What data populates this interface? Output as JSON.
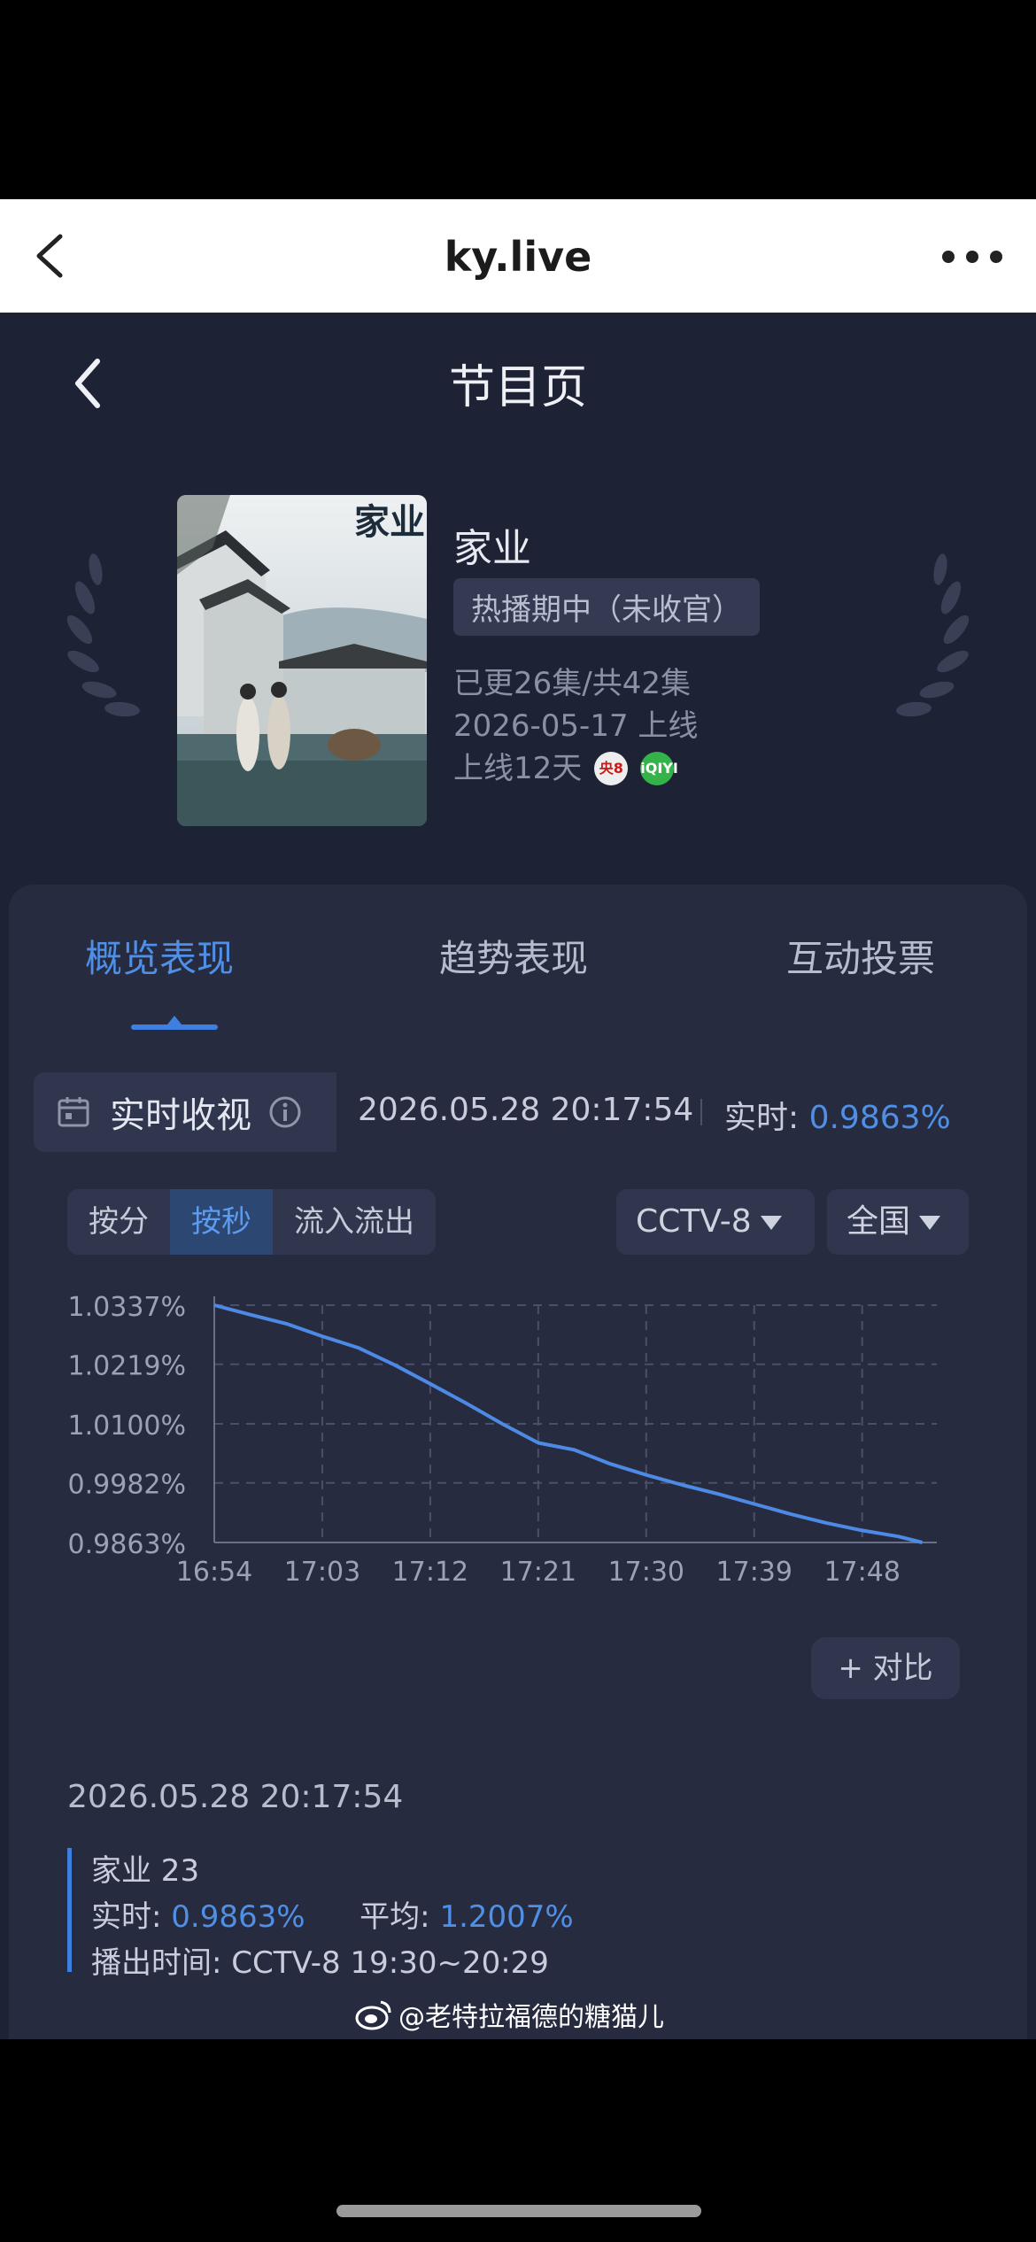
{
  "browser": {
    "url": "ky.live"
  },
  "page": {
    "title": "节目页"
  },
  "show": {
    "poster_title": "家业",
    "title": "家业",
    "status": "热播期中（未收官）",
    "episodes": "已更26集/共42集",
    "premiere": "2026-05-17 上线",
    "days_online": "上线12天",
    "platforms": [
      "央8",
      "iQIYI"
    ]
  },
  "tabs": [
    "概览表现",
    "趋势表现",
    "互动投票"
  ],
  "realtime": {
    "label": "实时收视",
    "timestamp": "2026.05.28 20:17:54",
    "value_label": "实时: ",
    "value": "0.9863%"
  },
  "filters": {
    "modes": [
      "按分",
      "按秒",
      "流入流出"
    ],
    "active_mode": "按秒",
    "channel": "CCTV-8",
    "region": "全国"
  },
  "chart_data": {
    "type": "line",
    "y_ticks": [
      "1.0337%",
      "1.0219%",
      "1.0100%",
      "0.9982%",
      "0.9863%"
    ],
    "ylim": [
      0.9863,
      1.0337
    ],
    "x_ticks": [
      "16:54",
      "17:03",
      "17:12",
      "17:21",
      "17:30",
      "17:39",
      "17:48"
    ],
    "grid": true,
    "series": [
      {
        "color": "#4d8ae6",
        "x": [
          "16:54",
          "16:57",
          "17:00",
          "17:03",
          "17:06",
          "17:09",
          "17:12",
          "17:15",
          "17:18",
          "17:21",
          "17:24",
          "17:27",
          "17:30",
          "17:33",
          "17:36",
          "17:39",
          "17:42",
          "17:45",
          "17:48",
          "17:51",
          "17:53"
        ],
        "values": [
          1.0337,
          1.0318,
          1.03,
          1.0275,
          1.0252,
          1.0218,
          1.018,
          1.0141,
          1.01,
          1.0062,
          1.0048,
          1.002,
          0.9998,
          0.9978,
          0.996,
          0.994,
          0.992,
          0.9902,
          0.9887,
          0.9875,
          0.9863
        ]
      }
    ]
  },
  "detail": {
    "timestamp": "2026.05.28 20:17:54",
    "episode": "家业 23",
    "realtime_label": "实时: ",
    "realtime_value": "0.9863%",
    "average_label": "平均: ",
    "average_value": "1.2007%",
    "airtime": "播出时间:  CCTV-8 19:30~20:29",
    "compare_button": "+ 对比"
  },
  "watermark": "@老特拉福德的糖猫儿",
  "colors": {
    "accent": "#4f8fe6",
    "background": "#1e2235",
    "panel": "#262b40"
  }
}
